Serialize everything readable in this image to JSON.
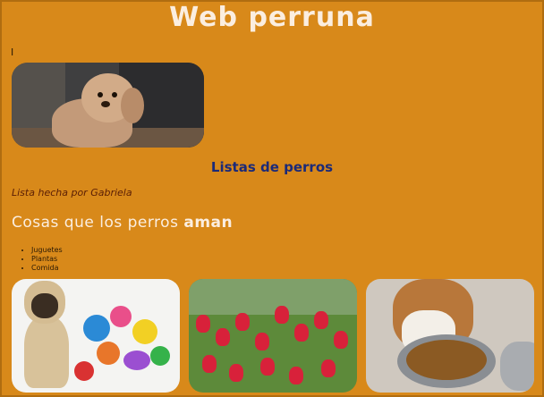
{
  "header": {
    "title": "Web perruna"
  },
  "cursor_text": "I",
  "main": {
    "subheading": "Listas de perros",
    "author": "Lista hecha por Gabriela",
    "loves_prefix": "Cosas que los perros ",
    "loves_emphasis": "aman",
    "list": [
      "Juguetes",
      "Plantas",
      "Comida"
    ]
  },
  "images": [
    {
      "icon": "poodle-photo"
    },
    {
      "icon": "pug-with-toys-photo"
    },
    {
      "icon": "tulips-photo"
    },
    {
      "icon": "beagle-eating-photo"
    }
  ],
  "colors": {
    "background": "#d8891a",
    "title": "#fbeee0",
    "subheading": "#1b2a78",
    "author": "#5a1e05"
  }
}
